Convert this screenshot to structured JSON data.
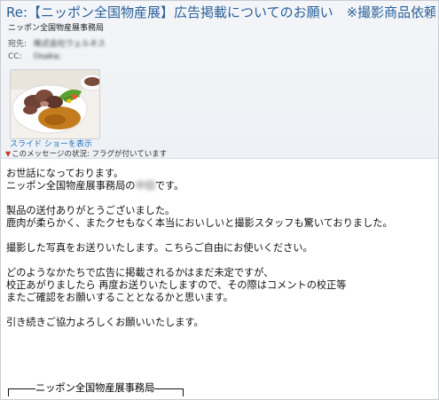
{
  "email": {
    "subject": "Re:【ニッポン全国物産展】広告掲載についてのお願い　※撮影商品依頼",
    "sender": "ニッポン全国物産展事務局",
    "to_label": "宛先:",
    "to_value": "株式会社ウェルネス",
    "cc_label": "CC:",
    "cc_value": "Osaka;",
    "slideshow_link": "スライド ショーを表示",
    "flag_status": "このメッセージの状況: フラグが付いています",
    "body": {
      "greeting": "お世話になっております。",
      "intro_prefix": "ニッポン全国物産展事務局の",
      "intro_name": "中田",
      "intro_suffix": "です。",
      "thanks": "製品の送付ありがとうございました。",
      "praise": "鹿肉が柔らかく、またクセもなく本当においしいと撮影スタッフも驚いておりました。",
      "photos": "撮影した写真をお送りいたします。こちらご自由にお使いください。",
      "plan_1": "どのようなかたちで広告に掲載されるかはまだ未定ですが、",
      "plan_2": "校正あがりましたら 再度お送りいたしますので、その際はコメントの校正等",
      "plan_3": "またご確認をお願いすることとなるかと思います。",
      "closing": "引き続きご協力よろしくお願いいたします。"
    },
    "signature": "ニッポン全国物産展事務局"
  }
}
